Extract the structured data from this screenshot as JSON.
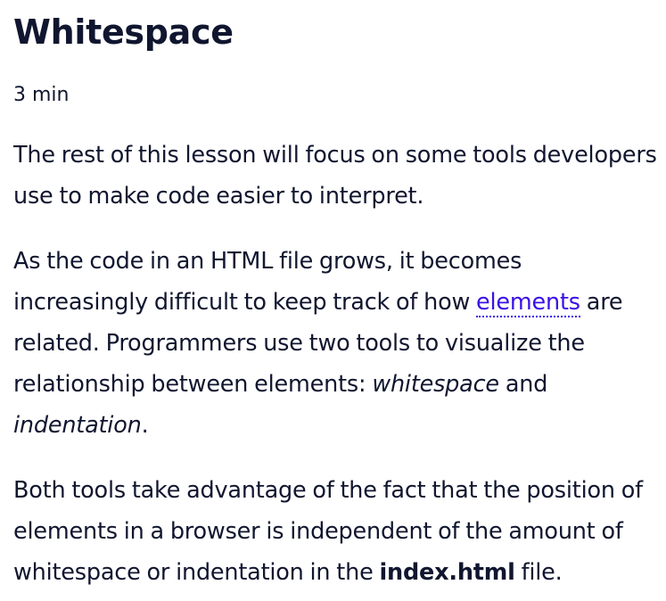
{
  "lesson": {
    "title": "Whitespace",
    "duration": "3 min",
    "paragraph1": "The rest of this lesson will focus on some tools developers use to make code easier to interpret.",
    "paragraph2": {
      "before_link": "As the code in an HTML file grows, it becomes increasingly difficult to keep track of how ",
      "link": "elements",
      "after_link": " are related. Programmers use two tools to visualize the relationship between elements: ",
      "term1": "whitespace",
      "connector": " and ",
      "term2": "indentation",
      "end": "."
    },
    "paragraph3": {
      "before_bold": "Both tools take advantage of the fact that the position of elements in a browser is independent of the amount of whitespace or indentation in the ",
      "bold": "index.html",
      "after_bold": " file."
    },
    "link_color": "#3a10e5",
    "text_color": "#10162f"
  }
}
